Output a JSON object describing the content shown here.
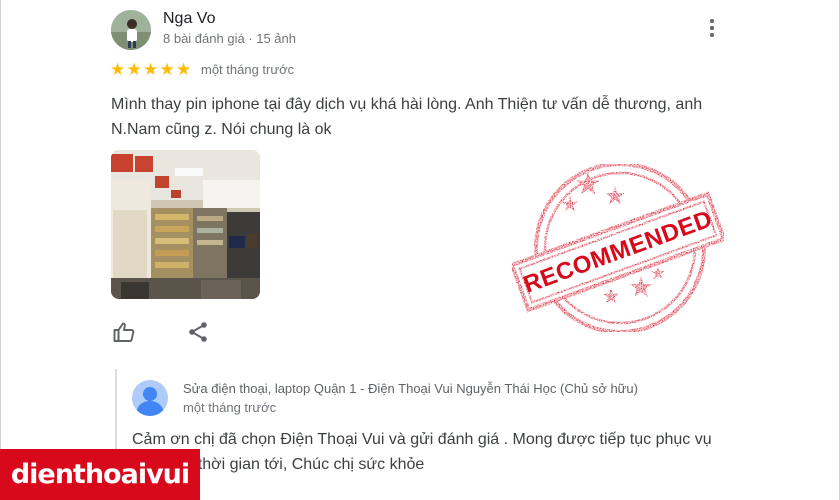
{
  "review": {
    "reviewer_name": "Nga Vo",
    "reviewer_meta": "8 bài đánh giá · 15 ảnh",
    "rating": 5,
    "star_glyph": "★",
    "date": "một tháng trước",
    "text": "Mình thay pin iphone tại đây dịch vụ khá hài lòng. Anh Thiện tư vấn dễ thương, anh N.Nam cũng z. Nói chung là ok",
    "actions": {
      "like_icon": "thumbs-up-icon",
      "share_icon": "share-icon",
      "more_icon": "more-vertical-icon"
    }
  },
  "stamp": {
    "label": "RECOMMENDED",
    "color": "#d7091b"
  },
  "owner_reply": {
    "name": "Sửa điện thoại, laptop Quận 1 - Điện Thoại Vui Nguyễn Thái Học (Chủ sở hữu)",
    "date": "một tháng trước",
    "text": "Cảm ơn chị đã chọn Điện Thoại Vui và gửi đánh giá . Mong được tiếp tục phục vụ chị trong thời gian tới, Chúc chị sức khỏe"
  },
  "brand": {
    "logo_text": "dienthoaivui",
    "color": "#d7091b"
  },
  "colors": {
    "star": "#fbbc04",
    "text": "#3c4043",
    "muted": "#70757a",
    "owner_avatar": "#aecbfa"
  }
}
